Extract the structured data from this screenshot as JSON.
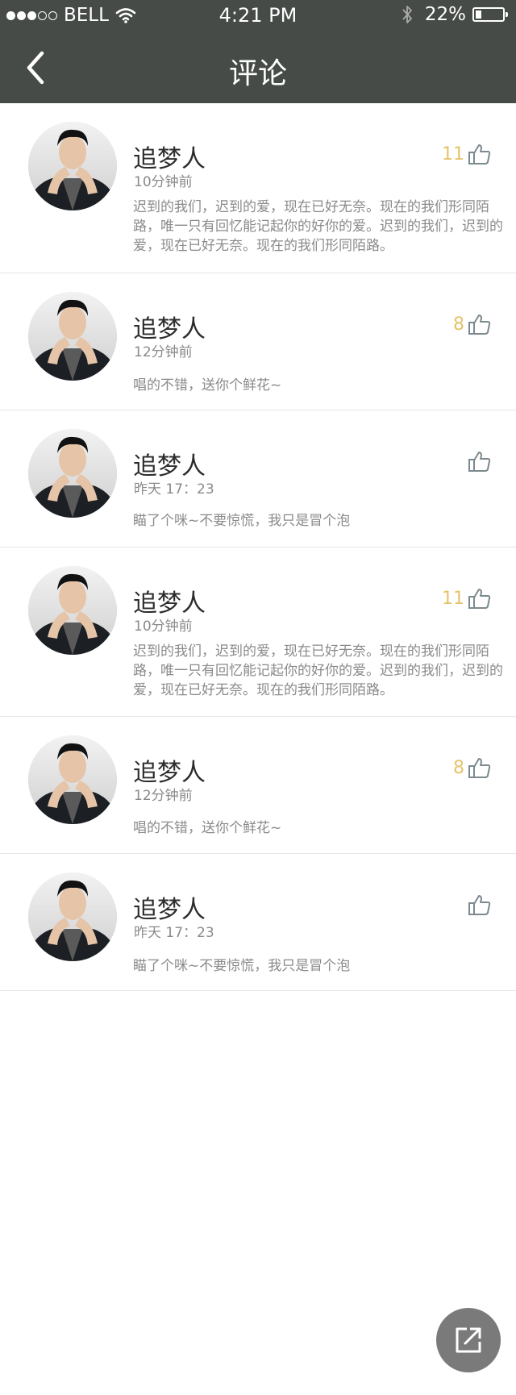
{
  "status_bar": {
    "carrier": "BELL",
    "time": "4:21 PM",
    "battery": "22%",
    "battery_level": 0.22
  },
  "nav": {
    "title": "评论"
  },
  "comments": [
    {
      "name": "追梦人",
      "time": "10分钟前",
      "likes": "11",
      "text": "迟到的我们，迟到的爱，现在已好无奈。现在的我们形同陌路，唯一只有回忆能记起你的好你的爱。迟到的我们，迟到的爱，现在已好无奈。现在的我们形同陌路。"
    },
    {
      "name": "追梦人",
      "time": "12分钟前",
      "likes": "8",
      "text": "唱的不错，送你个鲜花~"
    },
    {
      "name": "追梦人",
      "time": "昨天  17：23",
      "likes": "",
      "text": "瞄了个咪~不要惊慌，我只是冒个泡"
    },
    {
      "name": "追梦人",
      "time": "10分钟前",
      "likes": "11",
      "text": "迟到的我们，迟到的爱，现在已好无奈。现在的我们形同陌路，唯一只有回忆能记起你的好你的爱。迟到的我们，迟到的爱，现在已好无奈。现在的我们形同陌路。"
    },
    {
      "name": "追梦人",
      "time": "12分钟前",
      "likes": "8",
      "text": "唱的不错，送你个鲜花~"
    },
    {
      "name": "追梦人",
      "time": "昨天  17：23",
      "likes": "",
      "text": "瞄了个咪~不要惊慌，我只是冒个泡"
    }
  ],
  "icons": {
    "back": "back-arrow-icon",
    "like": "thumbs-up-icon",
    "share": "share-external-icon"
  },
  "colors": {
    "header_bg": "#464b48",
    "like_count": "#e6c36a",
    "fab_bg": "#7a7a7a"
  }
}
